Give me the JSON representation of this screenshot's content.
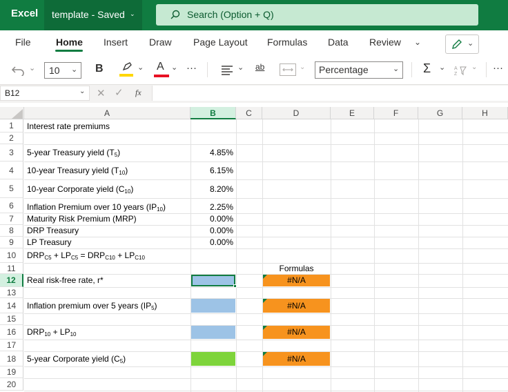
{
  "app": {
    "brand": "Excel",
    "doc_name": "template - Saved"
  },
  "search": {
    "placeholder": "Search (Option + Q)"
  },
  "menu": {
    "tabs": [
      {
        "label": "File"
      },
      {
        "label": "Home"
      },
      {
        "label": "Insert"
      },
      {
        "label": "Draw"
      },
      {
        "label": "Page Layout"
      },
      {
        "label": "Formulas"
      },
      {
        "label": "Data"
      },
      {
        "label": "Review"
      }
    ]
  },
  "ribbon": {
    "font_size": "10",
    "bold": "B",
    "font_color_letter": "A",
    "more": "···",
    "wrap": "ab",
    "number_format": "Percentage",
    "sum": "Σ"
  },
  "formula_bar": {
    "cell_ref": "B12",
    "fx": "fx",
    "content": ""
  },
  "grid": {
    "columns": [
      "A",
      "B",
      "C",
      "D",
      "E",
      "F",
      "G",
      "H"
    ],
    "rows": [
      "1",
      "2",
      "3",
      "4",
      "5",
      "6",
      "7",
      "8",
      "9",
      "10",
      "11",
      "12",
      "13",
      "14",
      "15",
      "16",
      "17",
      "18",
      "19",
      "20"
    ],
    "cells": {
      "a1": "Interest rate premiums",
      "a3_main": "5-year Treasury yield (T",
      "a3_sub": "5",
      "a3_end": ")",
      "a4_main": "10-year Treasury yield (T",
      "a4_sub": "10",
      "a4_end": ")",
      "a5_main": "10-year Corporate yield (C",
      "a5_sub": "10",
      "a5_end": ")",
      "a6_main": "Inflation Premium over 10 years (IP",
      "a6_sub": "10",
      "a6_end": ")",
      "a7": "Maturity Risk Premium (MRP)",
      "a8": "DRP Treasury",
      "a9": "LP Treasury",
      "a10_p1": "DRP",
      "a10_s1": "C5",
      "a10_p2": " + LP",
      "a10_s2": "C5",
      "a10_p3": " = DRP",
      "a10_s3": "C10",
      "a10_p4": " + LP",
      "a10_s4": "C10",
      "a12": "Real risk-free rate, r*",
      "a14_main": "Inflation premium over 5 years (IP",
      "a14_sub": "5",
      "a14_end": ")",
      "a16_p1": "DRP",
      "a16_s1": "10",
      "a16_p2": " + LP",
      "a16_s2": "10",
      "a18_main": "5-year Corporate yield (C",
      "a18_sub": "5",
      "a18_end": ")",
      "b3": "4.85%",
      "b4": "6.15%",
      "b5": "8.20%",
      "b6": "2.25%",
      "b7": "0.00%",
      "b8": "0.00%",
      "b9": "0.00%",
      "d11": "Formulas",
      "d12": "#N/A",
      "d14": "#N/A",
      "d16": "#N/A",
      "d18": "#N/A"
    }
  },
  "colors": {
    "brand_green": "#107c41",
    "input_blue": "#9dc3e6",
    "result_green": "#7ed43b",
    "formula_orange": "#f7931e"
  }
}
